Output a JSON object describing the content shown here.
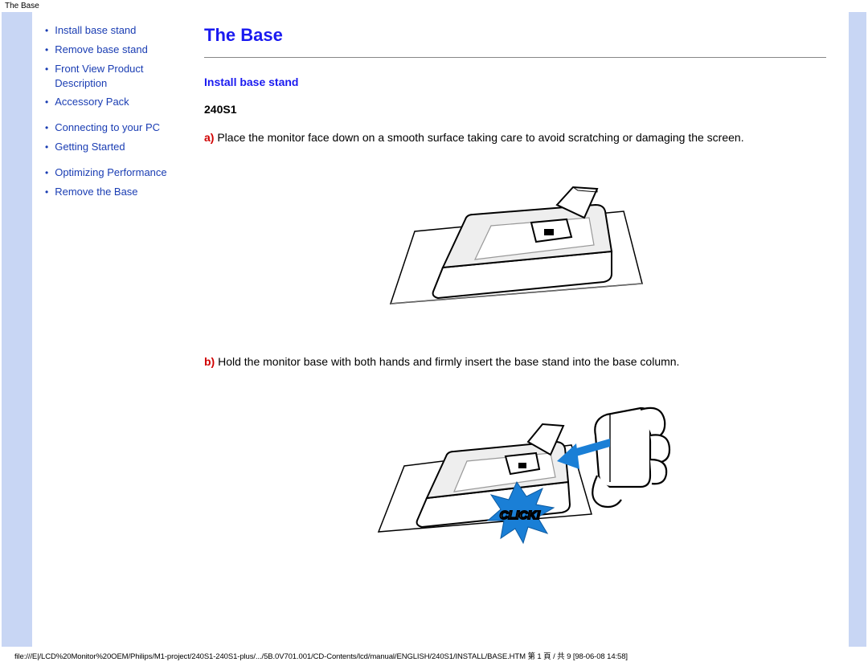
{
  "header": {
    "tab": "The Base"
  },
  "sidebar": {
    "items": [
      {
        "label": "Install base stand"
      },
      {
        "label": "Remove base stand"
      },
      {
        "label": "Front View Product Description"
      },
      {
        "label": "Accessory Pack"
      },
      {
        "label": "Connecting to your PC"
      },
      {
        "label": "Getting Started"
      },
      {
        "label": "Optimizing Performance"
      },
      {
        "label": "Remove the Base"
      }
    ]
  },
  "main": {
    "title": "The Base",
    "section_label": "Install base stand",
    "model": "240S1",
    "step_a": {
      "letter": "a)",
      "text": "Place the monitor face down on a smooth surface taking care to avoid scratching or damaging the screen."
    },
    "step_b": {
      "letter": "b)",
      "text": "Hold the monitor base with both hands and firmly insert the base stand into the base column."
    },
    "click_badge": "CLICK!"
  },
  "footer": {
    "path": "file:///E|/LCD%20Monitor%20OEM/Philips/M1-project/240S1-240S1-plus/.../5B.0V701.001/CD-Contents/lcd/manual/ENGLISH/240S1/INSTALL/BASE.HTM 第 1 頁 / 共 9  [98-06-08 14:58]"
  }
}
